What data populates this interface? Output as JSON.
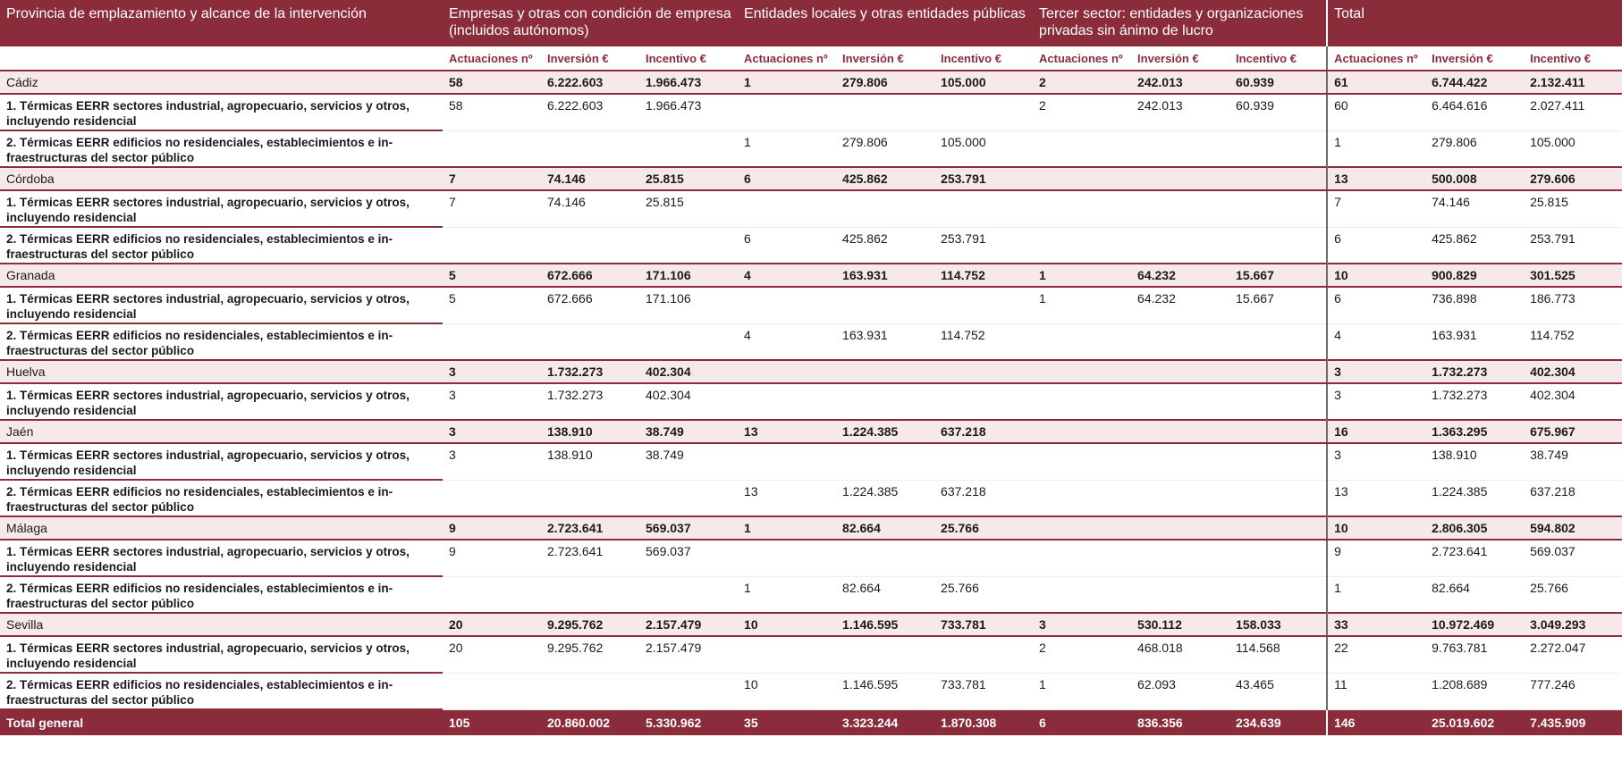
{
  "header": {
    "col_label": "Provincia de emplazamiento y alcance de la intervención",
    "groups": [
      "Empresas y otras con condición de empresa (incluidos autónomos)",
      "Entidades locales y otras entidades públicas",
      "Tercer sector: entidades y organizaciones privadas sin ánimo de lucro",
      "Total"
    ],
    "sub": [
      "Actuaciones nº",
      "Inversión €",
      "Incentivo €"
    ]
  },
  "provinces": [
    {
      "name": "Cádiz",
      "values": [
        "58",
        "6.222.603",
        "1.966.473",
        "1",
        "279.806",
        "105.000",
        "2",
        "242.013",
        "60.939",
        "61",
        "6.744.422",
        "2.132.411"
      ],
      "details": [
        {
          "name": "1. Térmicas EERR sectores industrial, agropecuario, servicios y otros, incluyendo residencial",
          "values": [
            "58",
            "6.222.603",
            "1.966.473",
            "",
            "",
            "",
            "2",
            "242.013",
            "60.939",
            "60",
            "6.464.616",
            "2.027.411"
          ]
        },
        {
          "name": "2. Térmicas EERR edificios no residenciales, establecimientos e in-fraestructuras del sector público",
          "values": [
            "",
            "",
            "",
            "1",
            "279.806",
            "105.000",
            "",
            "",
            "",
            "1",
            "279.806",
            "105.000"
          ]
        }
      ]
    },
    {
      "name": "Córdoba",
      "values": [
        "7",
        "74.146",
        "25.815",
        "6",
        "425.862",
        "253.791",
        "",
        "",
        "",
        "13",
        "500.008",
        "279.606"
      ],
      "details": [
        {
          "name": "1. Térmicas EERR sectores industrial, agropecuario, servicios y otros, incluyendo residencial",
          "values": [
            "7",
            "74.146",
            "25.815",
            "",
            "",
            "",
            "",
            "",
            "",
            "7",
            "74.146",
            "25.815"
          ]
        },
        {
          "name": "2. Térmicas EERR edificios no residenciales, establecimientos e in-fraestructuras del sector público",
          "values": [
            "",
            "",
            "",
            "6",
            "425.862",
            "253.791",
            "",
            "",
            "",
            "6",
            "425.862",
            "253.791"
          ]
        }
      ]
    },
    {
      "name": "Granada",
      "values": [
        "5",
        "672.666",
        "171.106",
        "4",
        "163.931",
        "114.752",
        "1",
        "64.232",
        "15.667",
        "10",
        "900.829",
        "301.525"
      ],
      "details": [
        {
          "name": "1. Térmicas EERR sectores industrial, agropecuario, servicios y otros, incluyendo residencial",
          "values": [
            "5",
            "672.666",
            "171.106",
            "",
            "",
            "",
            "1",
            "64.232",
            "15.667",
            "6",
            "736.898",
            "186.773"
          ]
        },
        {
          "name": "2. Térmicas EERR edificios no residenciales, establecimientos e in-fraestructuras del sector público",
          "values": [
            "",
            "",
            "",
            "4",
            "163.931",
            "114.752",
            "",
            "",
            "",
            "4",
            "163.931",
            "114.752"
          ]
        }
      ]
    },
    {
      "name": "Huelva",
      "values": [
        "3",
        "1.732.273",
        "402.304",
        "",
        "",
        "",
        "",
        "",
        "",
        "3",
        "1.732.273",
        "402.304"
      ],
      "details": [
        {
          "name": "1. Térmicas EERR sectores industrial, agropecuario, servicios y otros, incluyendo residencial",
          "values": [
            "3",
            "1.732.273",
            "402.304",
            "",
            "",
            "",
            "",
            "",
            "",
            "3",
            "1.732.273",
            "402.304"
          ]
        }
      ]
    },
    {
      "name": "Jaén",
      "values": [
        "3",
        "138.910",
        "38.749",
        "13",
        "1.224.385",
        "637.218",
        "",
        "",
        "",
        "16",
        "1.363.295",
        "675.967"
      ],
      "details": [
        {
          "name": "1. Térmicas EERR sectores industrial, agropecuario, servicios y otros, incluyendo residencial",
          "values": [
            "3",
            "138.910",
            "38.749",
            "",
            "",
            "",
            "",
            "",
            "",
            "3",
            "138.910",
            "38.749"
          ]
        },
        {
          "name": "2. Térmicas EERR edificios no residenciales, establecimientos e in-fraestructuras del sector público",
          "values": [
            "",
            "",
            "",
            "13",
            "1.224.385",
            "637.218",
            "",
            "",
            "",
            "13",
            "1.224.385",
            "637.218"
          ]
        }
      ]
    },
    {
      "name": "Málaga",
      "values": [
        "9",
        "2.723.641",
        "569.037",
        "1",
        "82.664",
        "25.766",
        "",
        "",
        "",
        "10",
        "2.806.305",
        "594.802"
      ],
      "details": [
        {
          "name": "1. Térmicas EERR sectores industrial, agropecuario, servicios y otros, incluyendo residencial",
          "values": [
            "9",
            "2.723.641",
            "569.037",
            "",
            "",
            "",
            "",
            "",
            "",
            "9",
            "2.723.641",
            "569.037"
          ]
        },
        {
          "name": "2. Térmicas EERR edificios no residenciales, establecimientos e in-fraestructuras del sector público",
          "values": [
            "",
            "",
            "",
            "1",
            "82.664",
            "25.766",
            "",
            "",
            "",
            "1",
            "82.664",
            "25.766"
          ]
        }
      ]
    },
    {
      "name": "Sevilla",
      "values": [
        "20",
        "9.295.762",
        "2.157.479",
        "10",
        "1.146.595",
        "733.781",
        "3",
        "530.112",
        "158.033",
        "33",
        "10.972.469",
        "3.049.293"
      ],
      "details": [
        {
          "name": "1. Térmicas EERR sectores industrial, agropecuario, servicios y otros, incluyendo residencial",
          "values": [
            "20",
            "9.295.762",
            "2.157.479",
            "",
            "",
            "",
            "2",
            "468.018",
            "114.568",
            "22",
            "9.763.781",
            "2.272.047"
          ]
        },
        {
          "name": "2. Térmicas EERR edificios no residenciales, establecimientos e in-fraestructuras del sector público",
          "values": [
            "",
            "",
            "",
            "10",
            "1.146.595",
            "733.781",
            "1",
            "62.093",
            "43.465",
            "11",
            "1.208.689",
            "777.246"
          ]
        }
      ]
    }
  ],
  "total": {
    "name": "Total general",
    "values": [
      "105",
      "20.860.002",
      "5.330.962",
      "35",
      "3.323.244",
      "1.870.308",
      "6",
      "836.356",
      "234.639",
      "146",
      "25.019.602",
      "7.435.909"
    ]
  }
}
